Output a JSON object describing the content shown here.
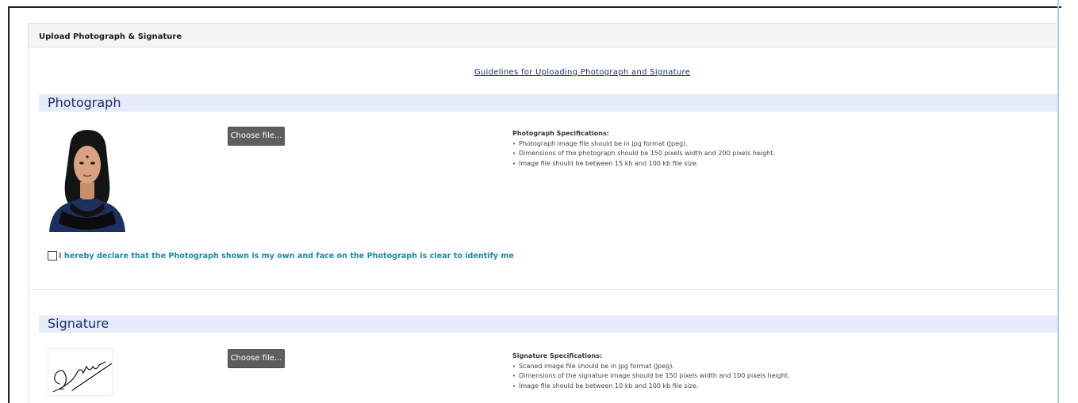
{
  "panel": {
    "title": "Upload Photograph & Signature",
    "guidelines_link": "Guidelines for Uploading Photograph and Signature"
  },
  "photograph": {
    "section_title": "Photograph",
    "choose_label": "Choose file...",
    "spec_title": "Photograph Specifications:",
    "specs": [
      "Photograph image file should be in jpg format (Jpeg).",
      "Dimensions of the photograph should be 150 pixels width and 200 pixels height.",
      "Image file should be between 15 kb and 100 kb file size."
    ],
    "declaration": "I hereby declare that the Photograph shown is my own and face on the Photograph is clear to identify me"
  },
  "signature": {
    "section_title": "Signature",
    "choose_label": "Choose file...",
    "spec_title": "Signature Specifications:",
    "specs": [
      "Scaned image file should be in jpg format (Jpeg).",
      "Dimensions of the signature image should be 150 pixels width and 100 pixels height.",
      "Image file should be between 10 kb and 100 kb file size."
    ]
  },
  "colors": {
    "section_bg": "#e6ecfc",
    "section_text": "#1c2a6b",
    "link": "#1a237e",
    "declaration": "#1b8aa0",
    "button_bg": "#5e5e5e"
  }
}
